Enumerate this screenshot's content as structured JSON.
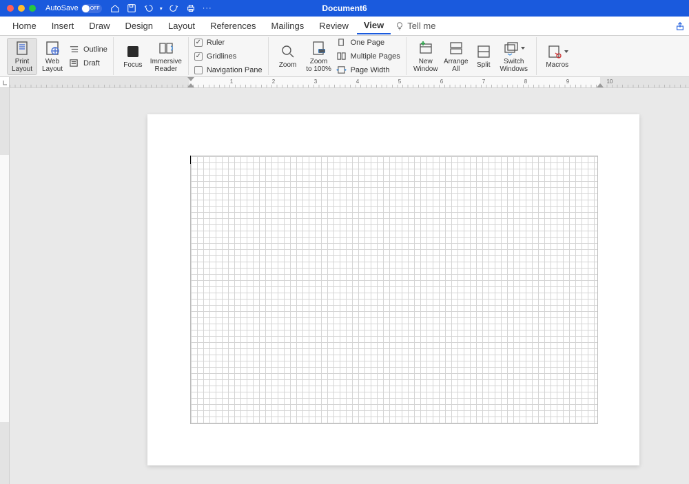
{
  "titlebar": {
    "autosave_label": "AutoSave",
    "autosave_state": "OFF",
    "document_title": "Document6"
  },
  "tabs": {
    "items": [
      "Home",
      "Insert",
      "Draw",
      "Design",
      "Layout",
      "References",
      "Mailings",
      "Review",
      "View"
    ],
    "active": "View",
    "tell_me": "Tell me"
  },
  "ribbon": {
    "views": {
      "print_layout": "Print\nLayout",
      "web_layout": "Web\nLayout",
      "outline": "Outline",
      "draft": "Draft"
    },
    "immersive": {
      "focus": "Focus",
      "immersive_reader": "Immersive\nReader"
    },
    "show": {
      "ruler": "Ruler",
      "gridlines": "Gridlines",
      "navigation_pane": "Navigation Pane",
      "ruler_checked": true,
      "gridlines_checked": true,
      "navigation_checked": false
    },
    "zoom": {
      "zoom": "Zoom",
      "zoom_100": "Zoom\nto 100%",
      "one_page": "One Page",
      "multiple_pages": "Multiple Pages",
      "page_width": "Page Width"
    },
    "window": {
      "new_window": "New\nWindow",
      "arrange_all": "Arrange\nAll",
      "split": "Split",
      "switch_windows": "Switch\nWindows"
    },
    "macros": {
      "macros": "Macros"
    }
  },
  "ruler": {
    "numbers": [
      "1",
      "2",
      "3",
      "4",
      "5",
      "6",
      "7",
      "8",
      "9",
      "10"
    ]
  }
}
